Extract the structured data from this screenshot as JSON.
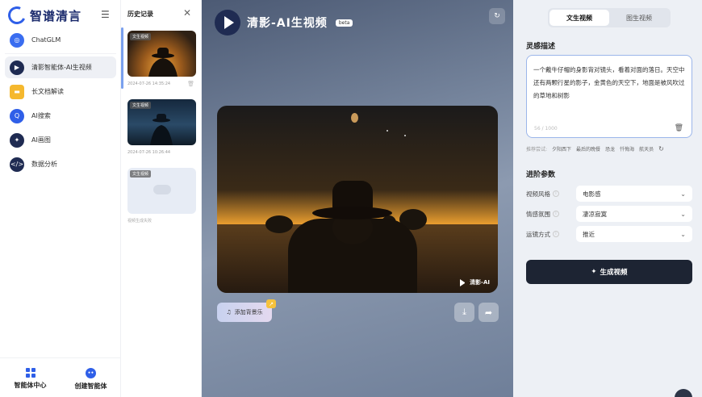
{
  "app": {
    "logo_text": "智谱清言"
  },
  "sidebar": {
    "items": [
      {
        "label": "ChatGLM",
        "icon": "chatglm-icon",
        "color": "#3a6df0"
      },
      {
        "label": "清影智能体-AI生视频",
        "icon": "qingying-icon",
        "color": "#1f2b52",
        "active": true
      },
      {
        "label": "长文档解读",
        "icon": "folder-icon",
        "color": "#f5b82e"
      },
      {
        "label": "AI搜索",
        "icon": "ai-search-icon",
        "color": "#2f5fe8"
      },
      {
        "label": "AI画图",
        "icon": "ai-paint-icon",
        "color": "#1f2b52"
      },
      {
        "label": "数据分析",
        "icon": "code-icon",
        "color": "#1f2b52"
      }
    ],
    "bottom": {
      "agent_center": "智能体中心",
      "create_agent": "创建智能体"
    }
  },
  "history": {
    "title": "历史记录",
    "items": [
      {
        "tag": "文生视频",
        "time": "2024-07-26 14:35:24"
      },
      {
        "tag": "文生视频",
        "time": "2024-07-26 10:26:44"
      },
      {
        "tag": "文生视频",
        "time": "视频生成失败"
      }
    ]
  },
  "stage": {
    "brand_title": "清影-AI生视频",
    "beta": "beta",
    "watermark": "清影-AI",
    "music_button": "添加背景乐"
  },
  "panel": {
    "tabs": [
      {
        "label": "文生视频",
        "active": true
      },
      {
        "label": "图生视频",
        "active": false
      }
    ],
    "prompt_label": "灵感描述",
    "prompt_text": "一个戴牛仔帽的身影背对镜头，看着对面的落日。天空中还有两颗行星的影子，金黄色的天空下，地面是被风吹过的草地和树影",
    "prompt_count": "56 / 1000",
    "suggest_label": "推荐尝试:",
    "suggestions": [
      "夕阳西下",
      "最后的晚餐",
      "恐龙",
      "忏悔海",
      "航天员"
    ],
    "advanced_label": "进阶参数",
    "params": [
      {
        "label": "视频风格",
        "value": "电影感"
      },
      {
        "label": "情感氛围",
        "value": "凄凉寂寞"
      },
      {
        "label": "运镜方式",
        "value": "推近"
      }
    ],
    "generate_label": "生成视频"
  },
  "colors": {
    "accent": "#2f5fe8",
    "dark_button": "#1d2433",
    "panel_bg": "#edf0f5"
  }
}
